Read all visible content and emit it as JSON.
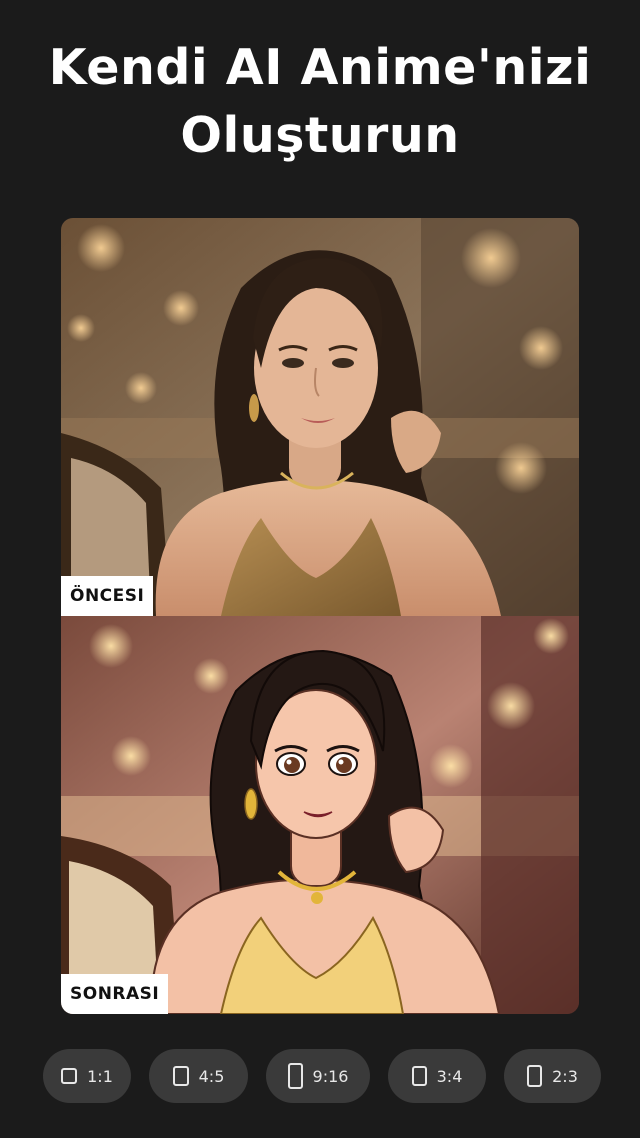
{
  "headline": {
    "line1": "Kendi AI Anime'nizi",
    "line2": "Oluşturun"
  },
  "comparison": {
    "before_label": "ÖNCESI",
    "after_label": "SONRASI"
  },
  "aspect_ratios": [
    {
      "label": "1:1",
      "icon": "square-ratio-icon"
    },
    {
      "label": "4:5",
      "icon": "portrait-4-5-ratio-icon"
    },
    {
      "label": "9:16",
      "icon": "portrait-9-16-ratio-icon"
    },
    {
      "label": "3:4",
      "icon": "portrait-3-4-ratio-icon"
    },
    {
      "label": "2:3",
      "icon": "portrait-2-3-ratio-icon"
    }
  ],
  "colors": {
    "background": "#1b1b1b",
    "chip_background": "#3a3a3a",
    "label_background": "#ffffff"
  }
}
